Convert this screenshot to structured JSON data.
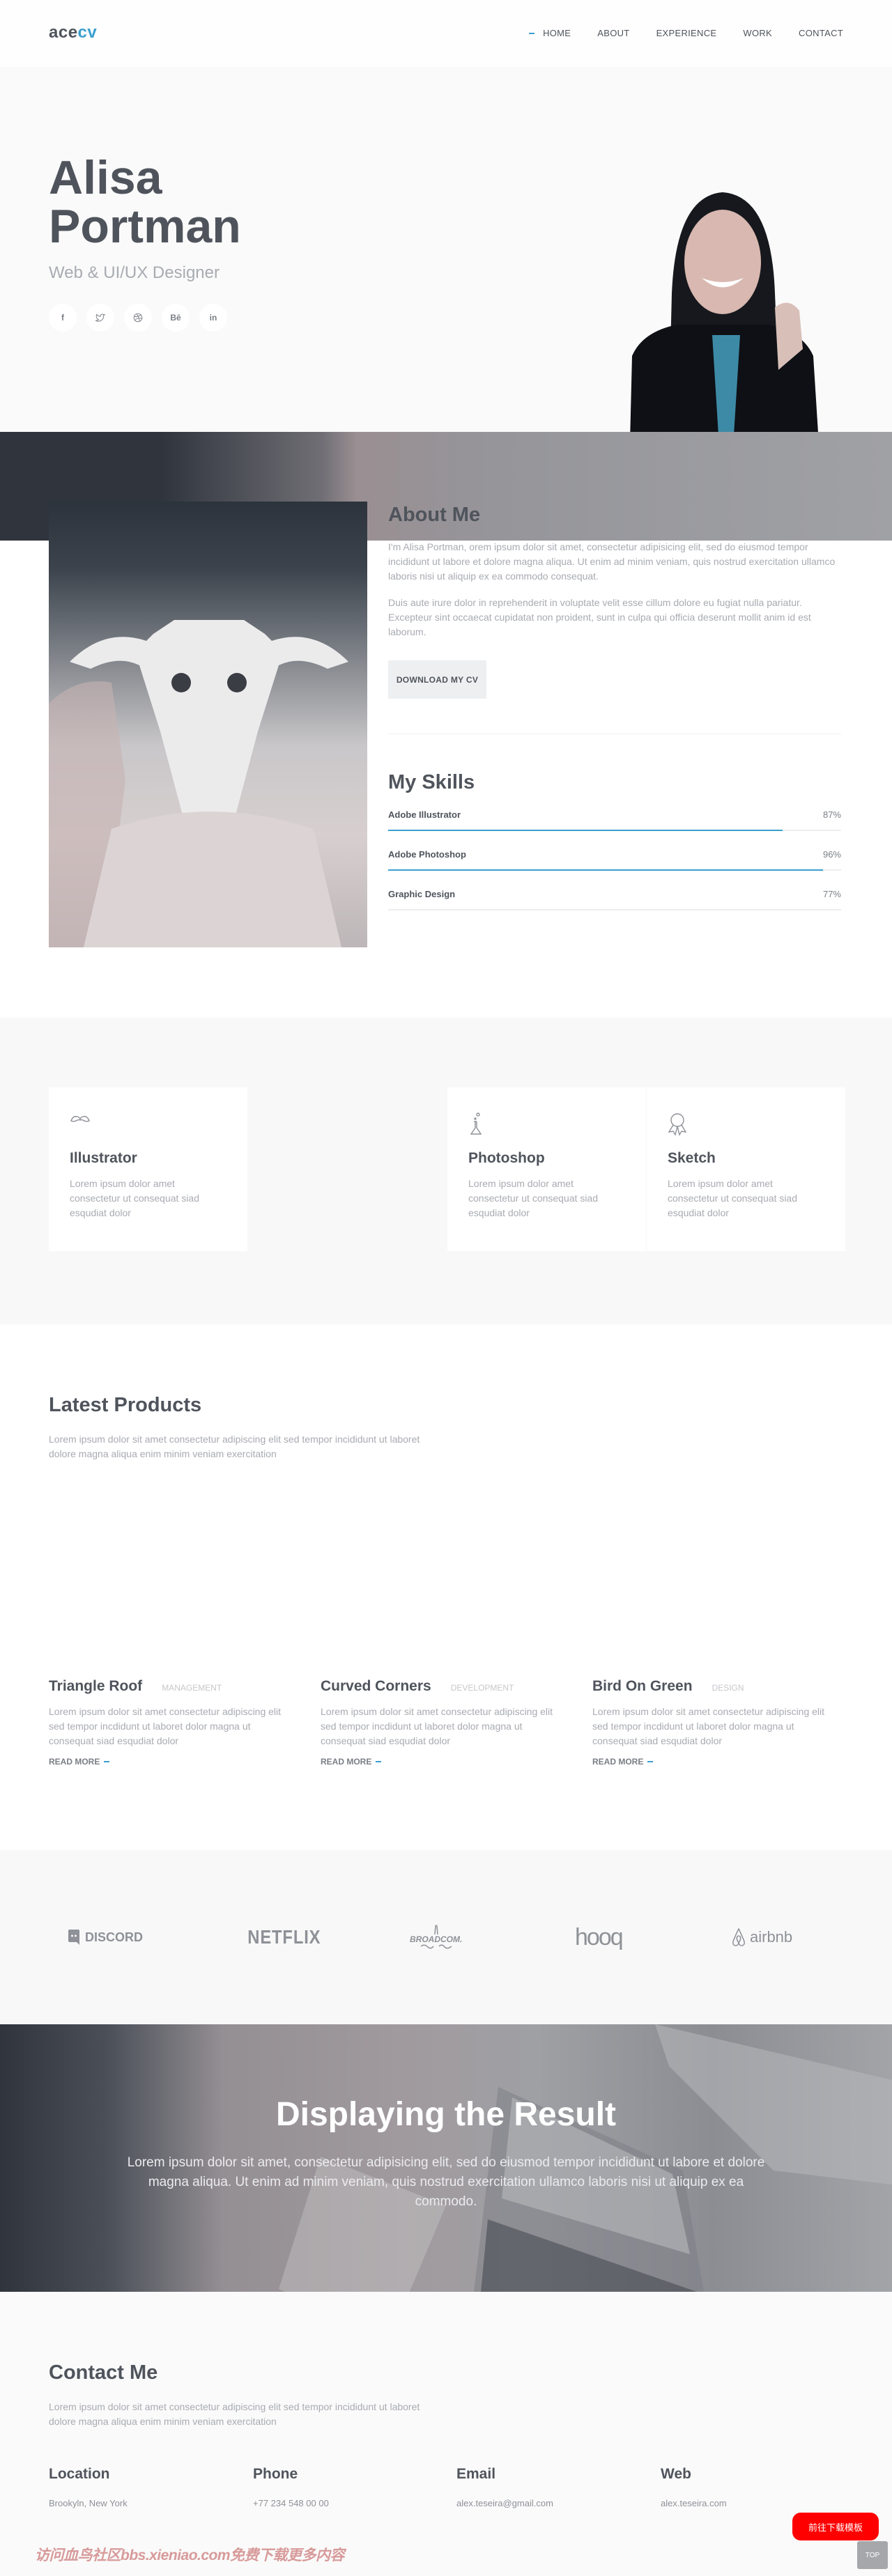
{
  "header": {
    "logo_main": "ace",
    "logo_accent": "cv",
    "nav": [
      {
        "label": "HOME",
        "active": true
      },
      {
        "label": "ABOUT",
        "active": false
      },
      {
        "label": "EXPERIENCE",
        "active": false
      },
      {
        "label": "WORK",
        "active": false
      },
      {
        "label": "CONTACT",
        "active": false
      }
    ]
  },
  "hero": {
    "first_name": "Alisa",
    "last_name": "Portman",
    "role": "Web & UI/UX Designer",
    "socials": [
      {
        "name": "facebook",
        "glyph": "f"
      },
      {
        "name": "twitter",
        "glyph": "t"
      },
      {
        "name": "dribbble",
        "glyph": "◎"
      },
      {
        "name": "behance",
        "glyph": "Bē"
      },
      {
        "name": "linkedin",
        "glyph": "in"
      }
    ]
  },
  "about": {
    "title": "About Me",
    "paragraph_1": "I'm Alisa Portman, orem ipsum dolor sit amet, consectetur adipisicing elit, sed do eiusmod tempor incididunt ut labore et dolore magna aliqua. Ut enim ad minim veniam, quis nostrud exercitation ullamco laboris nisi ut aliquip ex ea commodo consequat.",
    "paragraph_2": "Duis aute irure dolor in reprehenderit in voluptate velit esse cillum dolore eu fugiat nulla pariatur. Excepteur sint occaecat cupidatat non proident, sunt in culpa qui officia deserunt mollit anim id est laborum.",
    "download_label": "DOWNLOAD MY CV"
  },
  "skills": {
    "title": "My Skills",
    "items": [
      {
        "label": "Adobe Illustrator",
        "percent_label": "87%",
        "fill_percent": 87
      },
      {
        "label": "Adobe Photoshop",
        "percent_label": "96%",
        "fill_percent": 96
      },
      {
        "label": "Graphic Design",
        "percent_label": "77%",
        "fill_percent": 0
      }
    ]
  },
  "services": [
    {
      "icon": "mustache-icon",
      "title": "Illustrator",
      "text": "Lorem ipsum dolor amet consectetur ut consequat siad esqudiat dolor"
    },
    {
      "icon": "flask-icon",
      "title": "Photoshop",
      "text": "Lorem ipsum dolor amet consectetur ut consequat siad esqudiat dolor"
    },
    {
      "icon": "award-icon",
      "title": "Sketch",
      "text": "Lorem ipsum dolor amet consectetur ut consequat siad esqudiat dolor"
    }
  ],
  "products": {
    "title": "Latest Products",
    "subtitle": "Lorem ipsum dolor sit amet consectetur adipiscing elit sed tempor incididunt ut laboret dolore magna aliqua enim minim veniam exercitation",
    "read_more_label": "READ MORE",
    "items": [
      {
        "title": "Triangle Roof",
        "category": "MANAGEMENT",
        "text": "Lorem ipsum dolor sit amet consectetur adipiscing elit sed tempor incdidunt ut laboret dolor magna ut consequat siad esqudiat dolor"
      },
      {
        "title": "Curved Corners",
        "category": "DEVELOPMENT",
        "text": "Lorem ipsum dolor sit amet consectetur adipiscing elit sed tempor incdidunt ut laboret dolor magna ut consequat siad esqudiat dolor"
      },
      {
        "title": "Bird On Green",
        "category": "DESIGN",
        "text": "Lorem ipsum dolor sit amet consectetur adipiscing elit sed tempor incdidunt ut laboret dolor magna ut consequat siad esqudiat dolor"
      }
    ]
  },
  "clients": [
    {
      "name": "DISCORD"
    },
    {
      "name": "NETFLIX"
    },
    {
      "name": "BROADCOM."
    },
    {
      "name": "hooq"
    },
    {
      "name": "airbnb"
    }
  ],
  "banner": {
    "title": "Displaying the Result",
    "text": "Lorem ipsum dolor sit amet, consectetur adipisicing elit, sed do eiusmod tempor incididunt ut labore et dolore magna aliqua. Ut enim ad minim veniam, quis nostrud exercitation ullamco laboris nisi ut aliquip ex ea commodo."
  },
  "contact": {
    "title": "Contact Me",
    "subtitle": "Lorem ipsum dolor sit amet consectetur adipiscing elit sed tempor incididunt ut laboret dolore magna aliqua enim minim veniam exercitation",
    "items": [
      {
        "label": "Location",
        "value": "Brookyln, New York"
      },
      {
        "label": "Phone",
        "value": "+77 234 548 00 00"
      },
      {
        "label": "Email",
        "value": "alex.teseira@gmail.com"
      },
      {
        "label": "Web",
        "value": "alex.teseira.com"
      }
    ]
  },
  "overlay": {
    "download_template": "前往下载模板",
    "top_label": "TOP",
    "watermark": "访问血鸟社区bbs.xieniao.com免费下载更多内容"
  },
  "colors": {
    "accent": "#3a9fcf",
    "text_dark": "#4f545c",
    "text_muted": "#a8abb1"
  }
}
